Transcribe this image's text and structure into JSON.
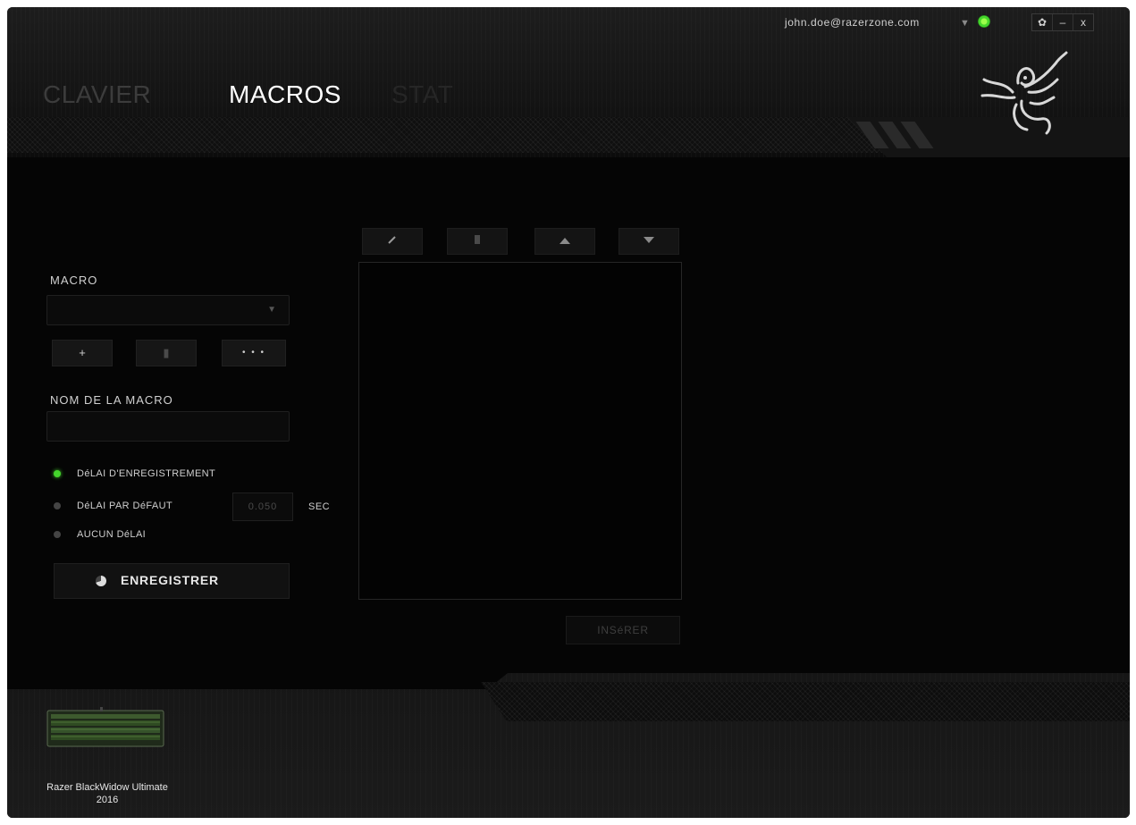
{
  "header": {
    "tabs": [
      {
        "label": "CLAVIER",
        "active": false
      },
      {
        "label": "MACROS",
        "active": true
      },
      {
        "label": "STAT",
        "active": false
      }
    ],
    "user_email": "john.doe@razerzone.com",
    "window_controls": {
      "settings": "✿",
      "minimize": "–",
      "close": "x"
    }
  },
  "macro_panel": {
    "macro_label": "MACRO",
    "macro_select_value": "",
    "add_button": "+",
    "delete_button": "▮",
    "more_button": "• • •",
    "name_label": "NOM DE LA MACRO",
    "name_value": "",
    "delay_options": [
      {
        "label": "DéLAI D'ENREGISTREMENT",
        "selected": true
      },
      {
        "label": "DéLAI PAR DéFAUT",
        "selected": false
      },
      {
        "label": "AUCUN DéLAI",
        "selected": false
      }
    ],
    "default_delay_value": "0.050",
    "delay_unit": "SEC",
    "record_button": "ENREGISTRER"
  },
  "editor": {
    "edit_icon": "pencil-icon",
    "delete_icon": "trash-icon",
    "up_icon": "arrow-up-icon",
    "down_icon": "arrow-down-icon",
    "insert_button": "INSéRER"
  },
  "device": {
    "name_line1": "Razer BlackWidow Ultimate",
    "name_line2": "2016"
  },
  "colors": {
    "accent": "#44d62c",
    "background": "#050505"
  }
}
